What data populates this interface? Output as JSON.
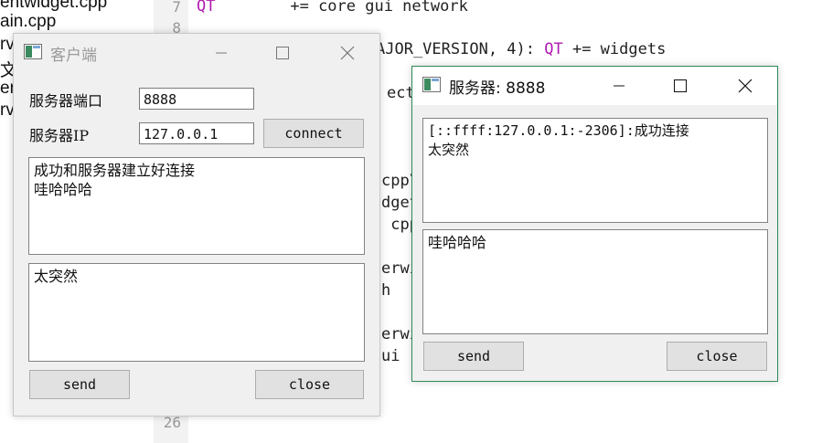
{
  "ide": {
    "files": [
      "entwidget.cpp",
      "ain.cpp",
      "rv",
      "文化",
      "er",
      "rv"
    ],
    "line_numbers": [
      "7",
      "8",
      "26"
    ],
    "code": {
      "line1_kw": "QT",
      "line1_rest": "        += core gui network",
      "line2_tail": "AJOR_VERSION, 4): ",
      "line2_kw": "QT",
      "line2_rest": " += widgets",
      "fragments": [
        "ect",
        "cpp\\",
        "dget",
        " cpp",
        "erwi",
        "h",
        "erwi",
        "ui"
      ]
    }
  },
  "client_window": {
    "title": "客户端",
    "port_label": "服务器端口",
    "port_value": "8888",
    "ip_label": "服务器IP",
    "ip_value": "127.0.0.1",
    "connect_label": "connect",
    "history_text": "成功和服务器建立好连接\n哇哈哈哈",
    "input_text": "太突然",
    "send_label": "send",
    "close_label": "close"
  },
  "server_window": {
    "title": "服务器: 8888",
    "history_text": "[::ffff:127.0.0.1:-2306]:成功连接\n太突然",
    "input_text": "哇哈哈哈",
    "send_label": "send",
    "close_label": "close"
  },
  "icons": {
    "app": "qt-window-icon",
    "minimize": "minimize-icon",
    "maximize": "maximize-icon",
    "close": "close-icon"
  },
  "colors": {
    "keyword": "#b01ab0",
    "server_border": "#2e8b57"
  }
}
